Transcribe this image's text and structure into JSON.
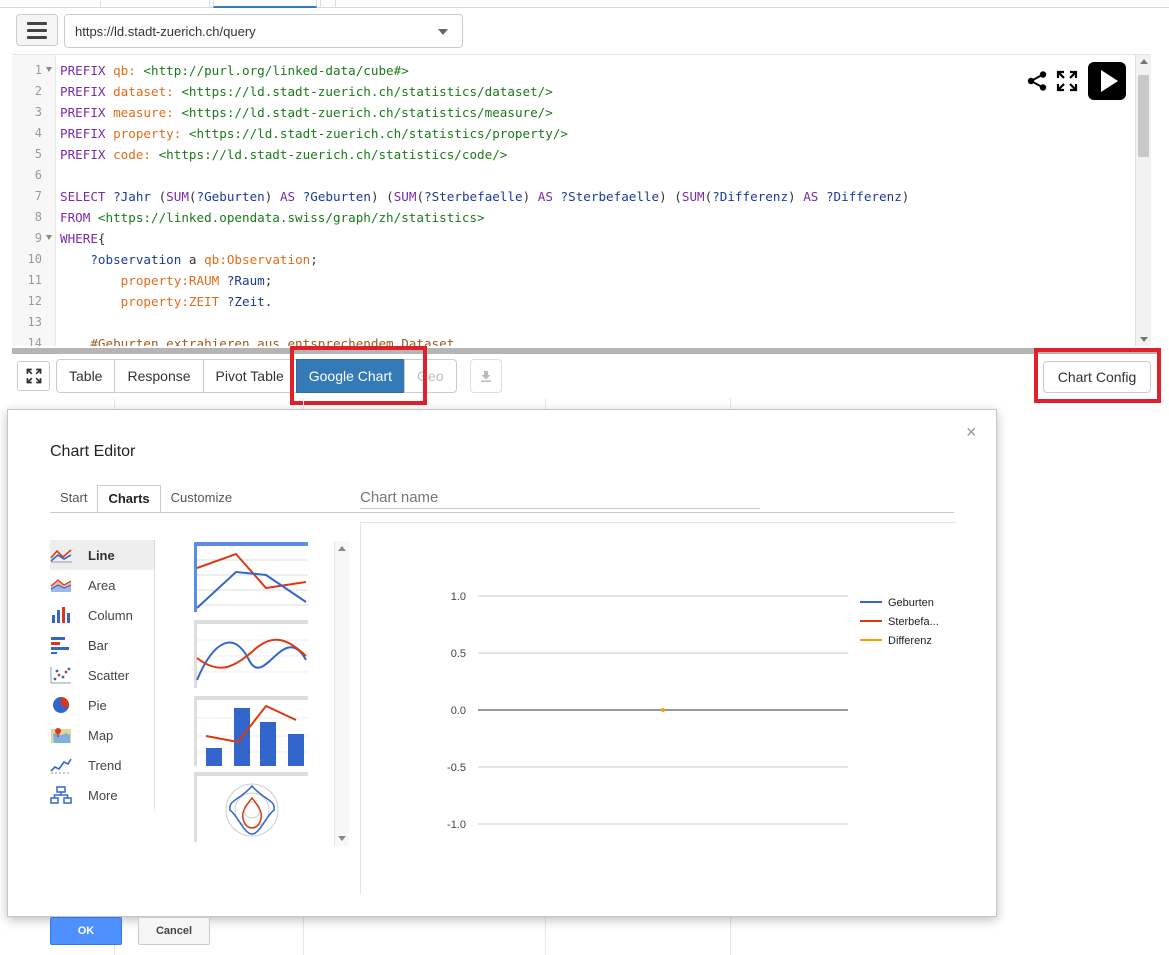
{
  "endpoint": {
    "url": "https://ld.stadt-zuerich.ch/query"
  },
  "editor": {
    "lines": [
      {
        "n": "1",
        "fold": true,
        "parts": [
          [
            "kw",
            "PREFIX "
          ],
          [
            "pfx",
            "qb: "
          ],
          [
            "uri",
            "<http://purl.org/linked-data/cube#>"
          ]
        ]
      },
      {
        "n": "2",
        "parts": [
          [
            "kw",
            "PREFIX "
          ],
          [
            "pfx",
            "dataset: "
          ],
          [
            "uri",
            "<https://ld.stadt-zuerich.ch/statistics/dataset/>"
          ]
        ]
      },
      {
        "n": "3",
        "parts": [
          [
            "kw",
            "PREFIX "
          ],
          [
            "pfx",
            "measure: "
          ],
          [
            "uri",
            "<https://ld.stadt-zuerich.ch/statistics/measure/>"
          ]
        ]
      },
      {
        "n": "4",
        "parts": [
          [
            "kw",
            "PREFIX "
          ],
          [
            "pfx",
            "property: "
          ],
          [
            "uri",
            "<https://ld.stadt-zuerich.ch/statistics/property/>"
          ]
        ]
      },
      {
        "n": "5",
        "parts": [
          [
            "kw",
            "PREFIX "
          ],
          [
            "pfx",
            "code: "
          ],
          [
            "uri",
            "<https://ld.stadt-zuerich.ch/statistics/code/>"
          ]
        ]
      },
      {
        "n": "6",
        "parts": []
      },
      {
        "n": "7",
        "parts": [
          [
            "kw",
            "SELECT "
          ],
          [
            "var",
            "?Jahr "
          ],
          [
            "plain",
            "("
          ],
          [
            "kw",
            "SUM"
          ],
          [
            "plain",
            "("
          ],
          [
            "var",
            "?Geburten"
          ],
          [
            "plain",
            ") "
          ],
          [
            "kw",
            "AS "
          ],
          [
            "var",
            "?Geburten"
          ],
          [
            "plain",
            ") ("
          ],
          [
            "kw",
            "SUM"
          ],
          [
            "plain",
            "("
          ],
          [
            "var",
            "?Sterbefaelle"
          ],
          [
            "plain",
            ") "
          ],
          [
            "kw",
            "AS "
          ],
          [
            "var",
            "?Sterbefaelle"
          ],
          [
            "plain",
            ") ("
          ],
          [
            "kw",
            "SUM"
          ],
          [
            "plain",
            "("
          ],
          [
            "var",
            "?Differenz"
          ],
          [
            "plain",
            ") "
          ],
          [
            "kw",
            "AS "
          ],
          [
            "var",
            "?Differenz"
          ],
          [
            "plain",
            ")"
          ]
        ]
      },
      {
        "n": "8",
        "parts": [
          [
            "kw",
            "FROM "
          ],
          [
            "uri",
            "<https://linked.opendata.swiss/graph/zh/statistics>"
          ]
        ]
      },
      {
        "n": "9",
        "fold": true,
        "parts": [
          [
            "kw",
            "WHERE"
          ],
          [
            "plain",
            "{"
          ]
        ]
      },
      {
        "n": "10",
        "parts": [
          [
            "plain",
            "    "
          ],
          [
            "var",
            "?observation "
          ],
          [
            "plain",
            "a "
          ],
          [
            "pfx",
            "qb:Observation"
          ],
          [
            "plain",
            ";"
          ]
        ]
      },
      {
        "n": "11",
        "parts": [
          [
            "plain",
            "        "
          ],
          [
            "pfx",
            "property:RAUM "
          ],
          [
            "var",
            "?Raum"
          ],
          [
            "plain",
            ";"
          ]
        ]
      },
      {
        "n": "12",
        "parts": [
          [
            "plain",
            "        "
          ],
          [
            "pfx",
            "property:ZEIT "
          ],
          [
            "var",
            "?Zeit"
          ],
          [
            "plain",
            "."
          ]
        ]
      },
      {
        "n": "13",
        "parts": []
      },
      {
        "n": "14",
        "parts": [
          [
            "plain",
            "    "
          ],
          [
            "cmt",
            "#Geburten extrahieren aus entsprechendem Dataset"
          ]
        ]
      }
    ]
  },
  "result_tabs": [
    {
      "label": "Table",
      "name": "tab-table",
      "state": "normal"
    },
    {
      "label": "Response",
      "name": "tab-response",
      "state": "normal"
    },
    {
      "label": "Pivot Table",
      "name": "tab-pivot-table",
      "state": "normal"
    },
    {
      "label": "Google Chart",
      "name": "tab-google-chart",
      "state": "active"
    },
    {
      "label": "Geo",
      "name": "tab-geo",
      "state": "disabled"
    }
  ],
  "chart_config_label": "Chart Config",
  "dialog": {
    "title": "Chart Editor",
    "close": "×",
    "tabs": [
      {
        "label": "Start",
        "active": false
      },
      {
        "label": "Charts",
        "active": true
      },
      {
        "label": "Customize",
        "active": false
      }
    ],
    "chart_name_placeholder": "Chart name",
    "chart_types": [
      {
        "label": "Line",
        "icon": "line-chart-icon",
        "active": true
      },
      {
        "label": "Area",
        "icon": "area-chart-icon",
        "active": false
      },
      {
        "label": "Column",
        "icon": "column-chart-icon",
        "active": false
      },
      {
        "label": "Bar",
        "icon": "bar-chart-icon",
        "active": false
      },
      {
        "label": "Scatter",
        "icon": "scatter-chart-icon",
        "active": false
      },
      {
        "label": "Pie",
        "icon": "pie-chart-icon",
        "active": false
      },
      {
        "label": "Map",
        "icon": "map-icon",
        "active": false
      },
      {
        "label": "Trend",
        "icon": "trend-icon",
        "active": false
      },
      {
        "label": "More",
        "icon": "more-icon",
        "active": false
      }
    ],
    "ok_label": "OK",
    "cancel_label": "Cancel"
  },
  "colors": {
    "accent": "#337ab7",
    "highlight": "#e0202a",
    "series_1": "#3366cc",
    "series_2": "#dc3912",
    "series_3": "#ff9900",
    "ok_button": "#4d90fe"
  },
  "chart_data": {
    "type": "line",
    "ylim": [
      -1.0,
      1.0
    ],
    "yticks": [
      "1.0",
      "0.5",
      "0.0",
      "-0.5",
      "-1.0"
    ],
    "ytick_values": [
      1.0,
      0.5,
      0.0,
      -0.5,
      -1.0
    ],
    "series": [
      {
        "name": "Geburten",
        "color": "#3366cc"
      },
      {
        "name": "Sterbefa...",
        "color": "#dc3912"
      },
      {
        "name": "Differenz",
        "color": "#ff9900"
      }
    ],
    "points": [
      {
        "x": 0.5,
        "y": 0.0,
        "series": "Differenz"
      }
    ],
    "legend": "right"
  }
}
